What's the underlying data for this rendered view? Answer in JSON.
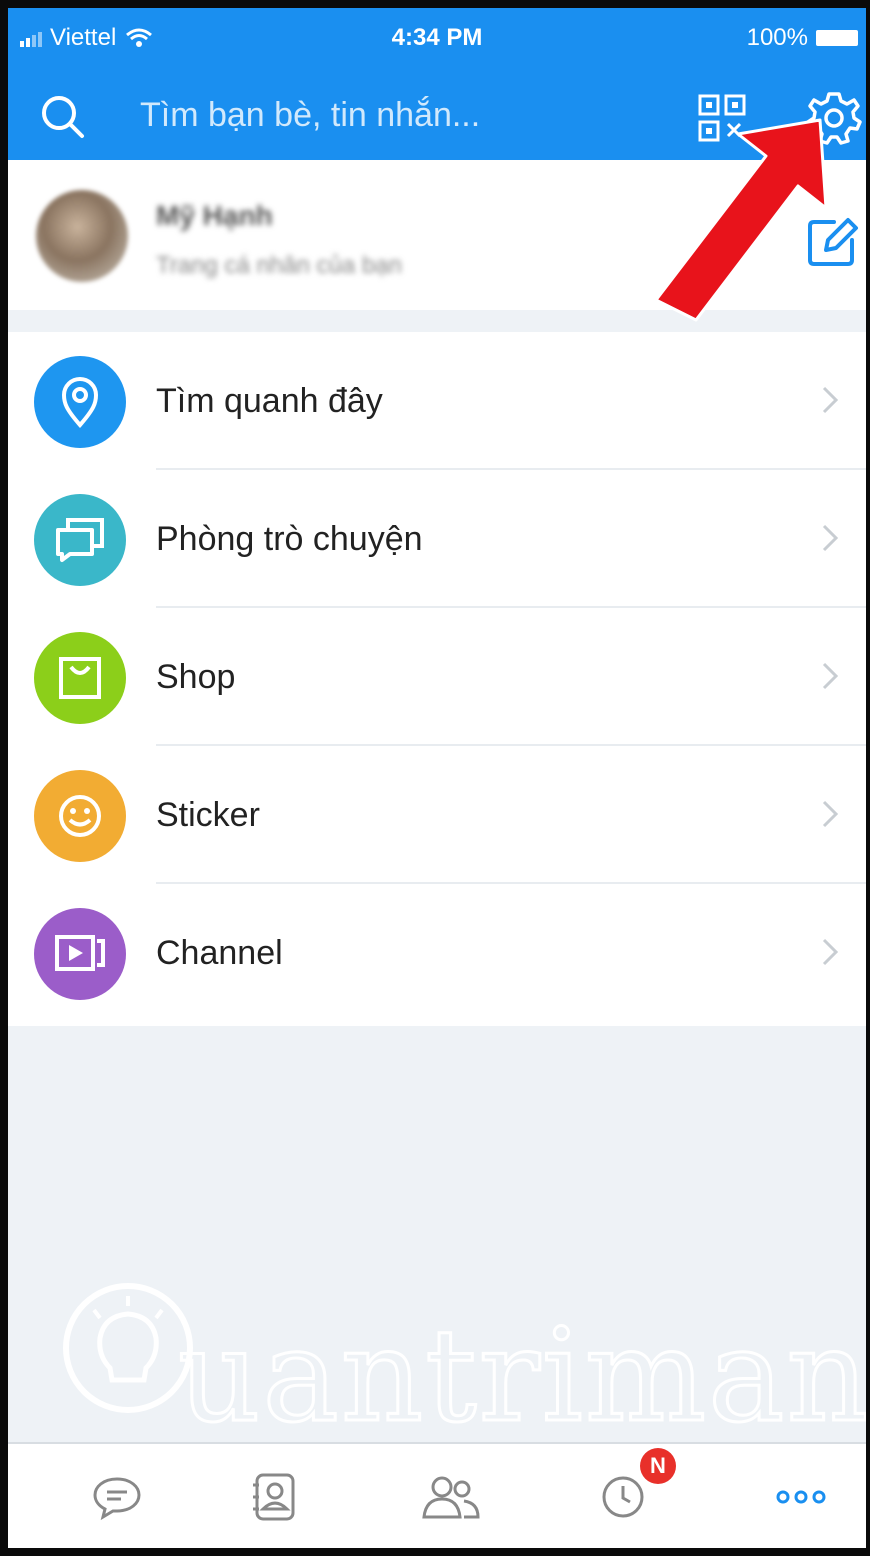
{
  "status_bar": {
    "carrier": "Viettel",
    "time": "4:34 PM",
    "battery": "100%"
  },
  "header": {
    "search_placeholder": "Tìm bạn bè, tin nhắn..."
  },
  "profile": {
    "name": "Mỹ Hạnh",
    "subtitle": "Trang cá nhân của bạn"
  },
  "menu": {
    "items": [
      {
        "label": "Tìm quanh đây",
        "icon": "location-pin-icon",
        "color": "#1e96f0"
      },
      {
        "label": "Phòng trò chuyện",
        "icon": "chat-room-icon",
        "color": "#3ab7c9"
      },
      {
        "label": "Shop",
        "icon": "shopping-bag-icon",
        "color": "#8ccf1a"
      },
      {
        "label": "Sticker",
        "icon": "smiley-icon",
        "color": "#f2ac33"
      },
      {
        "label": "Channel",
        "icon": "video-channel-icon",
        "color": "#9b5dc9"
      }
    ]
  },
  "watermark": {
    "text": "uantrimang"
  },
  "tabbar": {
    "items": [
      "messages-icon",
      "contacts-icon",
      "groups-icon",
      "timeline-icon",
      "more-icon"
    ],
    "badge": "N",
    "active_color": "#1a8ff0"
  },
  "colors": {
    "header_bg": "#1a8ff0",
    "arrow": "#e8131b"
  }
}
